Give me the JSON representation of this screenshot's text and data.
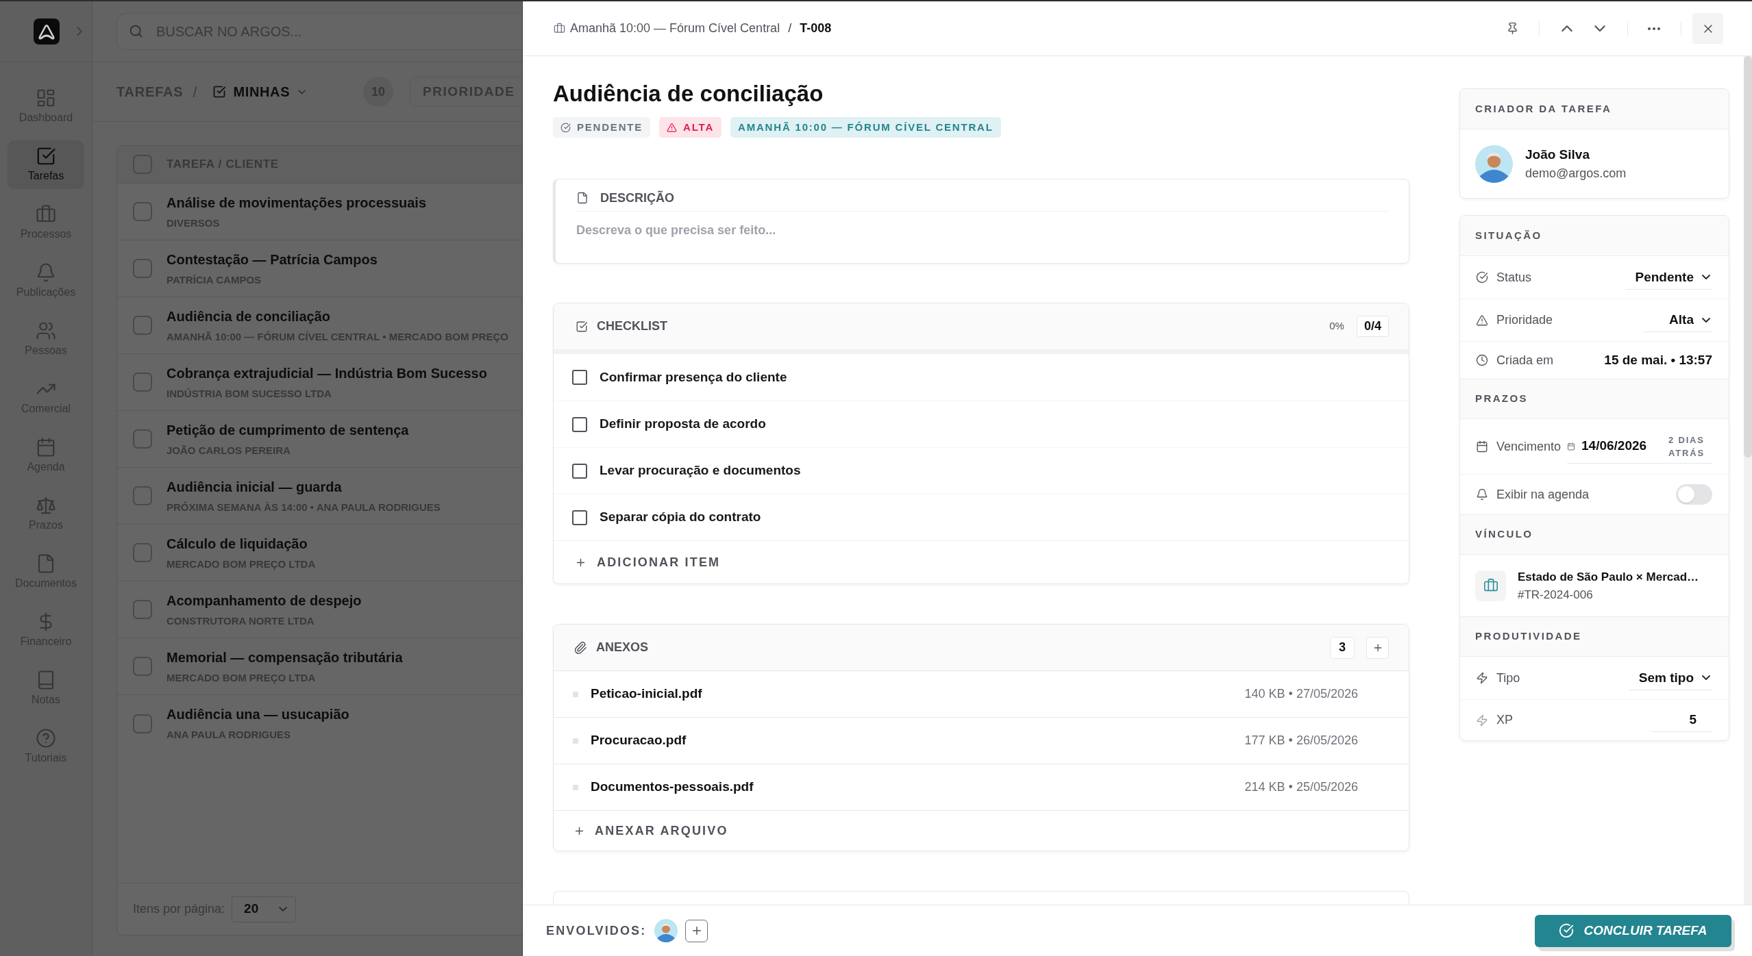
{
  "nav": {
    "items": [
      {
        "label": "Dashboard",
        "selected": false
      },
      {
        "label": "Tarefas",
        "selected": true
      },
      {
        "label": "Processos",
        "selected": false
      },
      {
        "label": "Publicações",
        "selected": false
      },
      {
        "label": "Pessoas",
        "selected": false
      },
      {
        "label": "Comercial",
        "selected": false
      },
      {
        "label": "Agenda",
        "selected": false
      },
      {
        "label": "Prazos",
        "selected": false
      },
      {
        "label": "Documentos",
        "selected": false
      },
      {
        "label": "Financeiro",
        "selected": false
      },
      {
        "label": "Notas",
        "selected": false
      },
      {
        "label": "Tutoriais",
        "selected": false
      }
    ]
  },
  "search": {
    "placeholder": "BUSCAR NO ARGOS..."
  },
  "toolbar": {
    "section": "TAREFAS",
    "separator": "/",
    "view": "MINHAS",
    "count": "10",
    "filter": "PRIORIDADE"
  },
  "table": {
    "column": "TAREFA / CLIENTE",
    "all_checked": false,
    "rows": [
      {
        "title": "Análise de movimentações processuais",
        "client": "DIVERSOS",
        "checked": false
      },
      {
        "title": "Contestação — Patrícia Campos",
        "client": "PATRÍCIA CAMPOS",
        "checked": false
      },
      {
        "title": "Audiência de conciliação",
        "client": "AMANHÃ 10:00 — FÓRUM CÍVEL CENTRAL • MERCADO BOM PREÇO",
        "checked": false
      },
      {
        "title": "Cobrança extrajudicial — Indústria Bom Sucesso",
        "client": "INDÚSTRIA BOM SUCESSO LTDA",
        "checked": false
      },
      {
        "title": "Petição de cumprimento de sentença",
        "client": "JOÃO CARLOS PEREIRA",
        "checked": false
      },
      {
        "title": "Audiência inicial — guarda",
        "client": "PRÓXIMA SEMANA ÀS 14:00 • ANA PAULA RODRIGUES",
        "checked": false
      },
      {
        "title": "Cálculo de liquidação",
        "client": "MERCADO BOM PREÇO LTDA",
        "checked": false
      },
      {
        "title": "Acompanhamento de despejo",
        "client": "CONSTRUTORA NORTE LTDA",
        "checked": false
      },
      {
        "title": "Memorial — compensação tributária",
        "client": "MERCADO BOM PREÇO LTDA",
        "checked": false
      },
      {
        "title": "Audiência una — usucapião",
        "client": "ANA PAULA RODRIGUES",
        "checked": false
      }
    ],
    "footer": {
      "label": "Itens por página:",
      "page_size": "20"
    }
  },
  "drawer": {
    "breadcrumb": {
      "parent": "Amanhã 10:00 — Fórum Cível Central",
      "separator": "/",
      "current": "T-008"
    },
    "title": "Audiência de conciliação",
    "badges": [
      {
        "kind": "status",
        "label": "PENDENTE"
      },
      {
        "kind": "priority",
        "label": "ALTA"
      },
      {
        "kind": "event",
        "label": "AMANHÃ 10:00 — FÓRUM CÍVEL CENTRAL"
      }
    ],
    "description": {
      "heading": "DESCRIÇÃO",
      "placeholder": "Descreva o que precisa ser feito..."
    },
    "checklist": {
      "heading": "CHECKLIST",
      "percent": "0%",
      "counter": "0/4",
      "progress": {
        "level": 0
      },
      "items": [
        {
          "label": "Confirmar presença do cliente",
          "checked": false
        },
        {
          "label": "Definir proposta de acordo",
          "checked": false
        },
        {
          "label": "Levar procuração e documentos",
          "checked": false
        },
        {
          "label": "Separar cópia do contrato",
          "checked": false
        }
      ],
      "add_label": "ADICIONAR ITEM"
    },
    "attachments": {
      "heading": "ANEXOS",
      "count": "3",
      "files": [
        {
          "name": "Peticao-inicial.pdf",
          "meta": "140 KB • 27/05/2026"
        },
        {
          "name": "Procuracao.pdf",
          "meta": "177 KB • 26/05/2026"
        },
        {
          "name": "Documentos-pessoais.pdf",
          "meta": "214 KB • 25/05/2026"
        }
      ],
      "add_label": "ANEXAR ARQUIVO"
    },
    "creator": {
      "heading": "CRIADOR DA TAREFA",
      "name": "João Silva",
      "email": "demo@argos.com"
    },
    "details": [
      {
        "heading": "SITUAÇÃO",
        "fields": [
          {
            "kind": "select",
            "label": "Status",
            "value": "Pendente"
          },
          {
            "kind": "select",
            "label": "Prioridade",
            "value": "Alta"
          },
          {
            "kind": "text",
            "label": "Criada em",
            "value": "15 de mai. • 13:57"
          }
        ]
      },
      {
        "heading": "PRAZOS",
        "fields": [
          {
            "kind": "date",
            "label": "Vencimento",
            "value": "14/06/2026",
            "note": "2 DIAS ATRÁS"
          },
          {
            "kind": "toggle",
            "label": "Exibir na agenda",
            "on": false
          }
        ]
      },
      {
        "heading": "VÍNCULO",
        "fields": [
          {
            "kind": "link",
            "title": "Estado de São Paulo × Mercad…",
            "code": "#TR-2024-006"
          }
        ]
      },
      {
        "heading": "PRODUTIVIDADE",
        "fields": [
          {
            "kind": "select",
            "label": "Tipo",
            "value": "Sem tipo"
          },
          {
            "kind": "number",
            "label": "XP",
            "value": "5"
          }
        ]
      }
    ],
    "footer": {
      "involved_label": "ENVOLVIDOS:",
      "complete_label": "CONCLUIR TAREFA"
    }
  }
}
